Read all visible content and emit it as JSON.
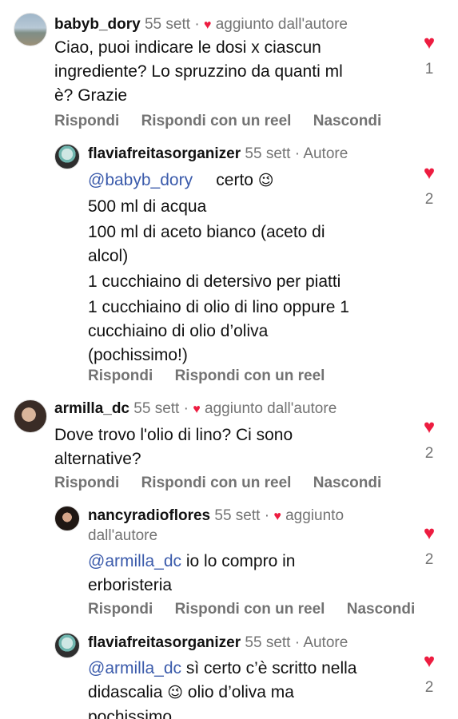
{
  "comments": [
    {
      "username": "babyb_dory",
      "time": "55 sett",
      "badge": "aggiunto dall'autore",
      "lines": [
        "Ciao, puoi indicare le dosi x ciascun",
        "ingrediente? Lo spruzzino da quanti ml",
        "è? Grazie"
      ],
      "likes": "1",
      "actions": [
        "Rispondi",
        "Rispondi con un reel",
        "Nascondi"
      ]
    },
    {
      "username": "flaviafreitasorganizer",
      "time": "55 sett",
      "badge": "Autore",
      "mention": "@babyb_dory",
      "first_text": "certo",
      "lines": [
        "500 ml di acqua",
        "100 ml di aceto bianco (aceto di",
        "alcol)",
        "1 cucchiaino di detersivo per piatti",
        "1 cucchiaino di olio di lino oppure 1",
        "cucchiaino di olio d’oliva",
        "(pochissimo!)"
      ],
      "likes": "2",
      "actions": [
        "Rispondi",
        "Rispondi con un reel"
      ]
    },
    {
      "username": "armilla_dc",
      "time": "55 sett",
      "badge": "aggiunto dall'autore",
      "lines": [
        "Dove trovo l'olio di lino? Ci sono",
        "alternative?"
      ],
      "likes": "2",
      "actions": [
        "Rispondi",
        "Rispondi con un reel",
        "Nascondi"
      ]
    },
    {
      "username": "nancyradioflores",
      "time": "55 sett",
      "badge": "aggiunto",
      "badge_cont": "dall'autore",
      "mention": "@armilla_dc",
      "first_text": "io lo compro in",
      "lines": [
        "erboristeria"
      ],
      "likes": "2",
      "actions": [
        "Rispondi",
        "Rispondi con un reel",
        "Nascondi"
      ]
    },
    {
      "username": "flaviafreitasorganizer",
      "time": "55 sett",
      "badge": "Autore",
      "mention": "@armilla_dc",
      "first_text": "sì certo c’è scritto nella",
      "second_text": "didascalia",
      "second_after": "olio d’oliva ma",
      "lines": [
        "pochissimo."
      ],
      "likes": "2"
    }
  ],
  "icons": {
    "heart": "heart-icon",
    "emoji": "winking-face-icon"
  },
  "colors": {
    "heart": "#ed1c40",
    "mention": "#3b5bab",
    "meta": "#737373"
  }
}
